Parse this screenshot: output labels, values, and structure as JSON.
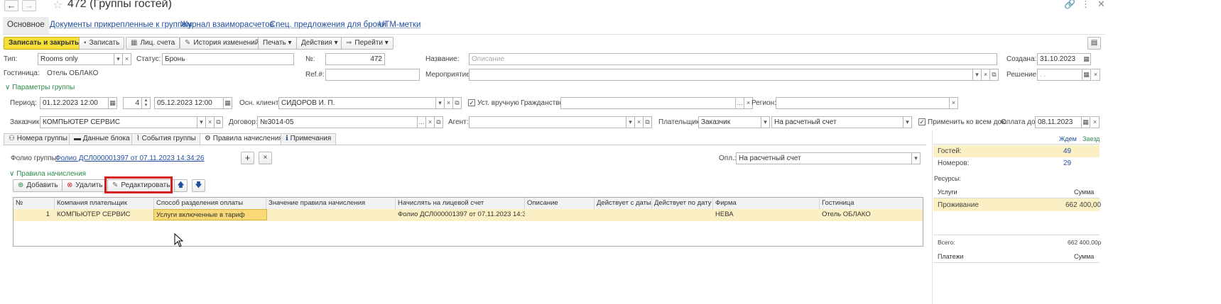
{
  "window": {
    "title": "472 (Группы гостей)"
  },
  "tabs": [
    {
      "label": "Основное"
    },
    {
      "label": "Документы прикрепленные к группам"
    },
    {
      "label": "Журнал взаиморасчетов"
    },
    {
      "label": "Спец. предложения для брони"
    },
    {
      "label": "UTM-метки"
    }
  ],
  "toolbar": {
    "save_close": "Записать и закрыть",
    "save": "Записать",
    "accounts": "Лиц. счета",
    "history": "История изменений",
    "print": "Печать",
    "actions": "Действия",
    "goto": "Перейти"
  },
  "form": {
    "type_label": "Тип:",
    "type_value": "Rooms only",
    "status_label": "Статус:",
    "status_value": "Бронь",
    "num_label": "№:",
    "num_value": "472",
    "name_label": "Название:",
    "name_placeholder": "Описание",
    "created_label": "Создана:",
    "created_value": "31.10.2023",
    "hotel_label": "Гостиница:",
    "hotel_value": "Отель ОБЛАКО",
    "ref_label": "Ref.#:",
    "event_label": "Мероприятие:",
    "decision_label": "Решение:",
    "decision_value": ". .",
    "group_params": "Параметры группы",
    "period_label": "Период:",
    "period_from": "01.12.2023 12:00",
    "nights": "4",
    "period_to": "05.12.2023 12:00",
    "main_client_label": "Осн. клиент:",
    "main_client_value": "СИДОРОВ И. П.",
    "manual_label": "Уст. вручную",
    "citizenship_label": "Гражданство:",
    "region_label": "Регион:",
    "customer_label": "Заказчик:",
    "customer_value": "КОМПЬЮТЕР СЕРВИС",
    "contract_label": "Договор:",
    "contract_value": "№3014-05",
    "agent_label": "Агент:",
    "payer_label": "Плательщик:",
    "payer_value": "Заказчик",
    "payment_method": "На расчетный счет",
    "apply_all_label": "Применить ко всем док.",
    "pay_until_label": "Оплата до:",
    "pay_until_value": "08.11.2023"
  },
  "subtabs": [
    {
      "label": "Номера группы",
      "icon": "rooms-icon"
    },
    {
      "label": "Данные блока",
      "icon": "block-icon"
    },
    {
      "label": "События группы",
      "icon": "paperclip-icon"
    },
    {
      "label": "Правила начисления",
      "icon": "rules-icon"
    },
    {
      "label": "Примечания",
      "icon": "info-icon"
    }
  ],
  "rules": {
    "folio_label": "Фолио группы:",
    "folio_value": "Фолио ДСЛ000001397 от 07.11.2023 14:34:26",
    "opl_label": "Опл.:",
    "opl_value": "На расчетный счет",
    "section": "Правила начисления",
    "add": "Добавить",
    "delete": "Удалить",
    "edit": "Редактировать"
  },
  "table": {
    "columns": [
      "№",
      "Компания плательщик",
      "Способ разделения оплаты",
      "Значение правила начисления",
      "Начислять на лицевой счет",
      "Описание",
      "Действует с даты",
      "Действует по дату",
      "Фирма",
      "Гостиница"
    ],
    "rows": [
      [
        "1",
        "КОМПЬЮТЕР СЕРВИС",
        "Услуги включенные в тариф",
        "",
        "Фолио ДСЛ000001397 от 07.11.2023 14:3...",
        "",
        "",
        "",
        "НЕВА",
        "Отель ОБЛАКО"
      ]
    ]
  },
  "right_panel": {
    "col_wait": "Ждем",
    "col_arrived": "Заезд",
    "guests_label": "Гостей:",
    "guests_value": "49",
    "rooms_label": "Номеров:",
    "rooms_value": "29",
    "resources_label": "Ресурсы:",
    "services_header": "Услуги",
    "sum_header": "Сумма",
    "service_name": "Проживание",
    "service_sum": "662 400,00",
    "total_label": "Всего:",
    "total_value": "662 400,00р",
    "payments_header": "Платежи",
    "payments_sum_header": "Сумма"
  }
}
